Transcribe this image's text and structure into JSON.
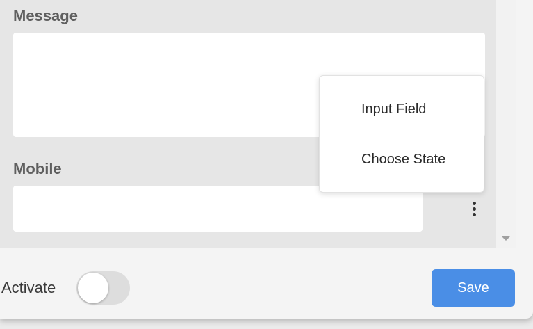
{
  "form": {
    "message_label": "Message",
    "message_value": "",
    "mobile_label": "Mobile",
    "mobile_value": ""
  },
  "context_menu": {
    "items": [
      {
        "label": "Input Field"
      },
      {
        "label": "Choose State"
      }
    ]
  },
  "footer": {
    "activate_label": "Activate",
    "activate_state": "off",
    "save_label": "Save"
  },
  "colors": {
    "accent": "#4a8ee6",
    "panel": "#e6e6e6",
    "input_bg": "#ffffff"
  },
  "icons": {
    "more_menu": "kebab-menu-icon",
    "scroll_down": "scroll-down-arrow-icon"
  }
}
